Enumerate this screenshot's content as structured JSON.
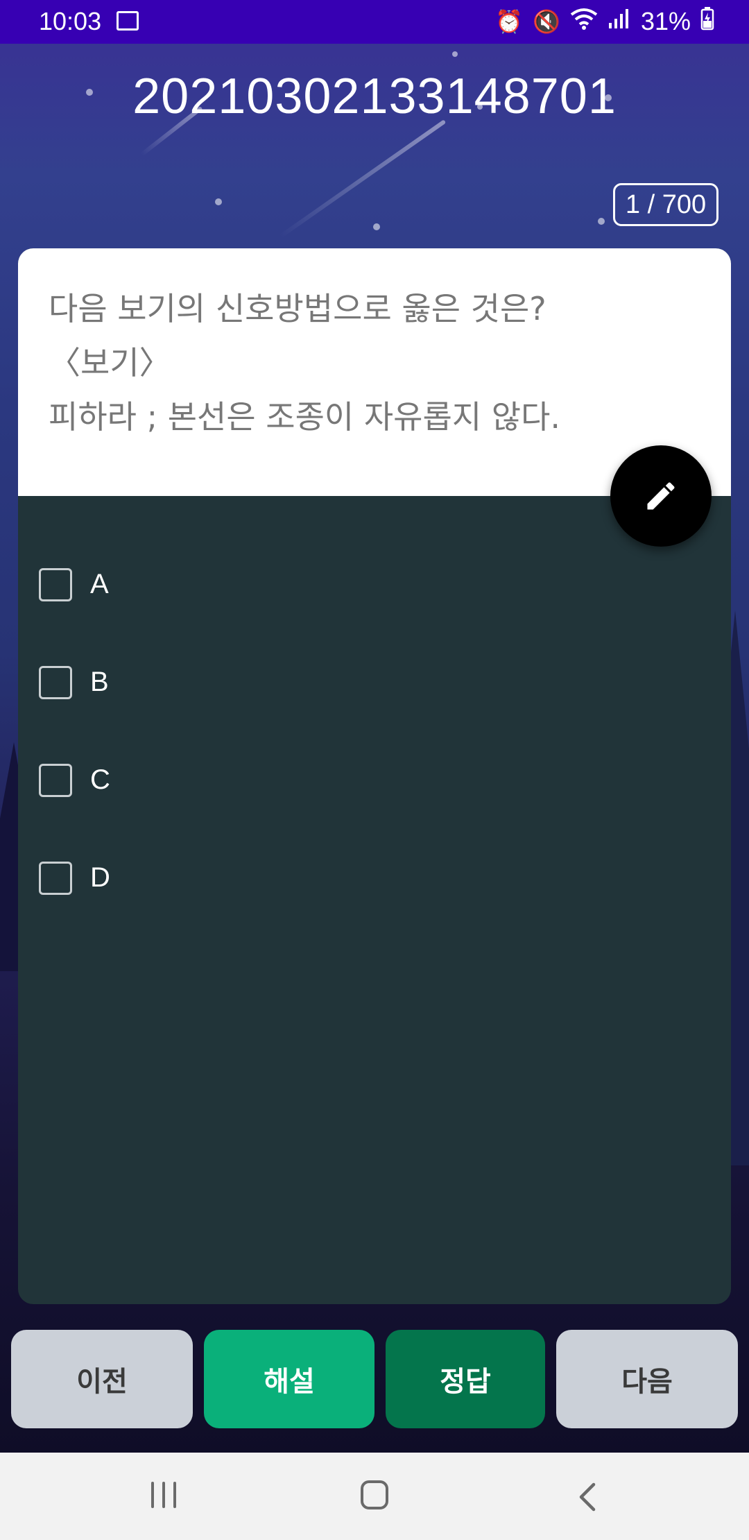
{
  "status_bar": {
    "time": "10:03",
    "battery": "31%",
    "icons": [
      "image-icon",
      "alarm-icon",
      "mute-icon",
      "wifi-icon",
      "signal-icon",
      "battery-icon"
    ]
  },
  "header": {
    "title": "20210302133148701",
    "counter": "1 / 700"
  },
  "question": {
    "lines": [
      "다음 보기의 신호방법으로 옳은 것은?",
      "〈보기〉",
      "피하라 ; 본선은 조종이 자유롭지 않다."
    ]
  },
  "options": [
    {
      "label": "A",
      "checked": false
    },
    {
      "label": "B",
      "checked": false
    },
    {
      "label": "C",
      "checked": false
    },
    {
      "label": "D",
      "checked": false
    }
  ],
  "fab": {
    "icon": "pencil-icon"
  },
  "buttons": {
    "prev": "이전",
    "explanation": "해설",
    "answer": "정답",
    "next": "다음"
  },
  "colors": {
    "status_bar": "#3700b3",
    "card_bg": "#213439",
    "btn_explanation": "#0ab07a",
    "btn_answer": "#04754c",
    "btn_nav": "#cbd0d8"
  }
}
